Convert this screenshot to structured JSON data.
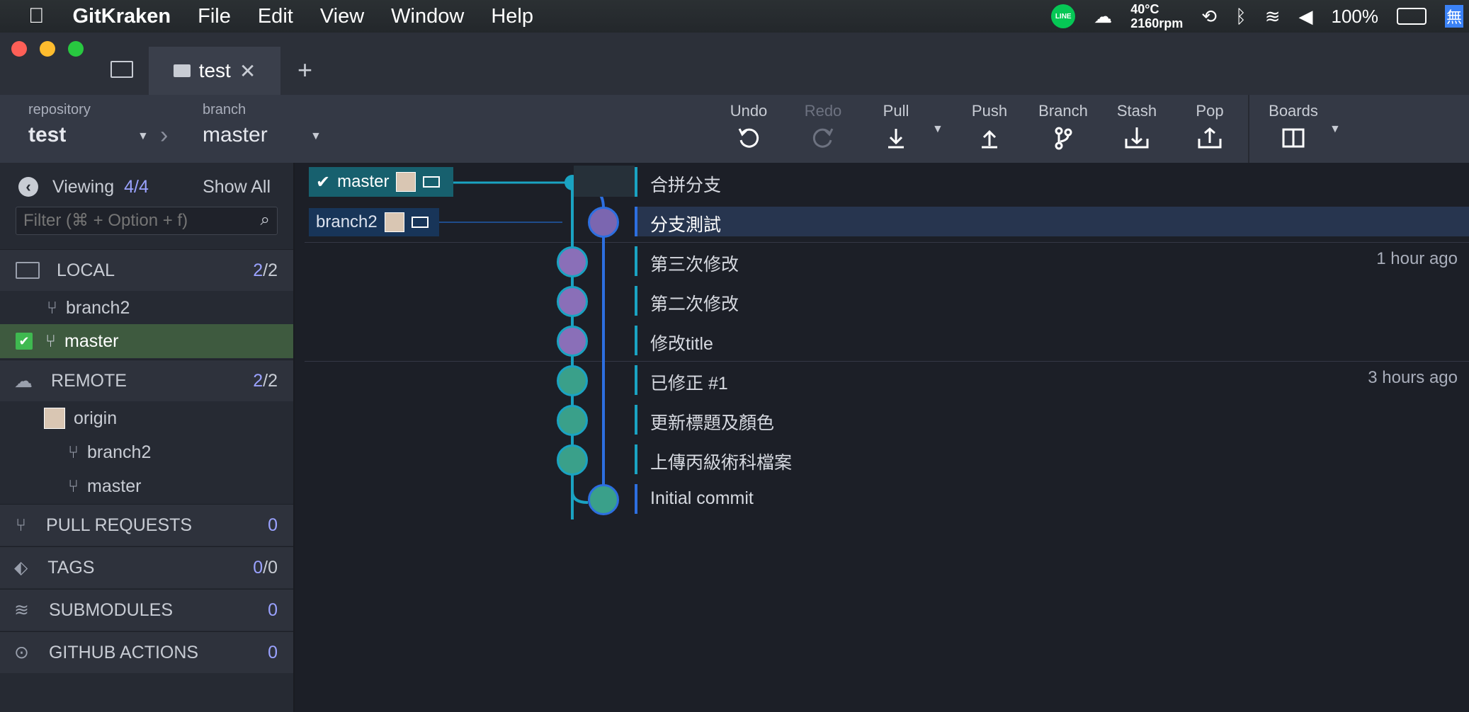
{
  "menubar": {
    "app": "GitKraken",
    "menus": [
      "File",
      "Edit",
      "View",
      "Window",
      "Help"
    ],
    "temp": "40°C",
    "rpm": "2160rpm",
    "battery": "100%",
    "input_method": "無"
  },
  "tabs": {
    "active": "test",
    "add": "+"
  },
  "toolbar": {
    "repo_label": "repository",
    "repo_value": "test",
    "branch_label": "branch",
    "branch_value": "master",
    "undo": "Undo",
    "redo": "Redo",
    "pull": "Pull",
    "push": "Push",
    "branch": "Branch",
    "stash": "Stash",
    "pop": "Pop",
    "boards": "Boards"
  },
  "sidebar": {
    "viewing": "Viewing",
    "viewing_count": "4/4",
    "show_all": "Show All",
    "filter_placeholder": "Filter (⌘ + Option + f)",
    "local": {
      "label": "LOCAL",
      "count_a": "2",
      "count_b": "/2",
      "items": [
        "branch2",
        "master"
      ]
    },
    "remote": {
      "label": "REMOTE",
      "count_a": "2",
      "count_b": "/2",
      "origin": "origin",
      "items": [
        "branch2",
        "master"
      ]
    },
    "pull_requests": {
      "label": "PULL REQUESTS",
      "count": "0"
    },
    "tags": {
      "label": "TAGS",
      "count_a": "0",
      "count_b": "/0"
    },
    "submodules": {
      "label": "SUBMODULES",
      "count": "0"
    },
    "github_actions": {
      "label": "GITHUB ACTIONS",
      "count": "0"
    }
  },
  "graph": {
    "branch_tags": [
      "master",
      "branch2"
    ],
    "commits": [
      {
        "message": "合拼分支",
        "time": ""
      },
      {
        "message": "分支測試",
        "time": ""
      },
      {
        "message": "第三次修改",
        "time": "1 hour ago"
      },
      {
        "message": "第二次修改",
        "time": ""
      },
      {
        "message": "修改title",
        "time": ""
      },
      {
        "message": "已修正 #1",
        "time": "3 hours ago"
      },
      {
        "message": "更新標題及顏色",
        "time": ""
      },
      {
        "message": "上傳丙級術科檔案",
        "time": ""
      },
      {
        "message": "Initial commit",
        "time": ""
      }
    ]
  }
}
